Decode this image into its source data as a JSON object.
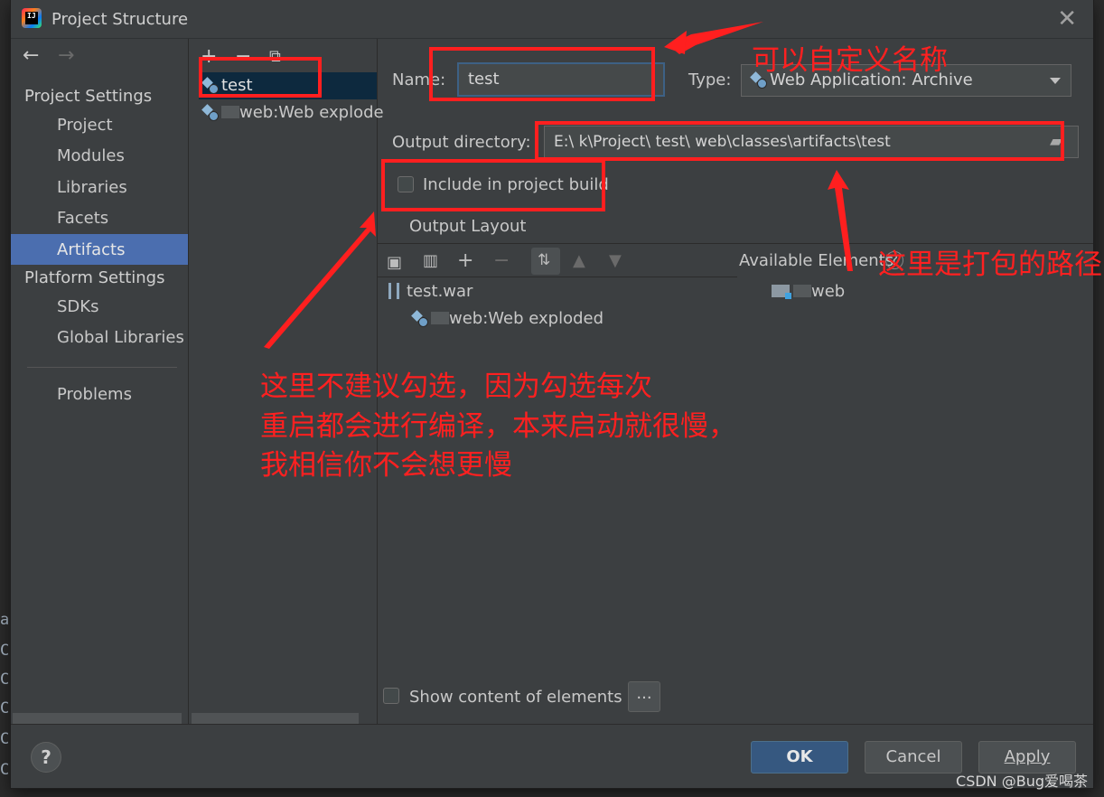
{
  "dialog": {
    "title": "Project Structure",
    "close_icon": "close-icon"
  },
  "nav": {
    "back_icon": "arrow-left-icon",
    "forward_icon": "arrow-right-icon",
    "project_settings": "Project Settings",
    "items_project": [
      "Project",
      "Modules",
      "Libraries",
      "Facets",
      "Artifacts"
    ],
    "platform_settings": "Platform Settings",
    "items_platform": [
      "SDKs",
      "Global Libraries"
    ],
    "problems": "Problems",
    "selected": "Artifacts"
  },
  "artifacts_list": {
    "add_icon": "plus-icon",
    "remove_icon": "minus-icon",
    "copy_icon": "copy-icon",
    "items": [
      "test",
      "web:Web explode"
    ]
  },
  "form": {
    "name_label": "Name:",
    "name_value": "test",
    "type_label": "Type:",
    "type_value": "Web Application: Archive",
    "output_dir_label": "Output directory:",
    "output_dir_value": "E:\\          k\\Project\\     test\\    web\\classes\\artifacts\\test",
    "include_build_label": "Include in project build",
    "include_build_checked": false,
    "output_layout_tab": "Output Layout"
  },
  "layout_tree": {
    "root": "test.war",
    "child": "web:Web exploded"
  },
  "available": {
    "title": "Available Elements",
    "help_icon": "help-icon",
    "item": "web"
  },
  "bottom": {
    "show_content_label": "Show content of elements",
    "show_content_checked": false,
    "more_button": "...",
    "ok": "OK",
    "cancel": "Cancel",
    "apply": "Apply"
  },
  "annotations": {
    "name_note": "可以自定义名称",
    "path_note": "这里是打包的路径",
    "build_note_line1": "这里不建议勾选，因为勾选每次",
    "build_note_line2": "重启都会进行编译，本来启动就很慢，",
    "build_note_line3": "我相信你不会想更慢",
    "color": "#ff1f1f"
  },
  "watermark": "CSDN @Bug爱喝茶",
  "background_console": {
    "line1": "at",
    "line_prefix": "Co"
  }
}
